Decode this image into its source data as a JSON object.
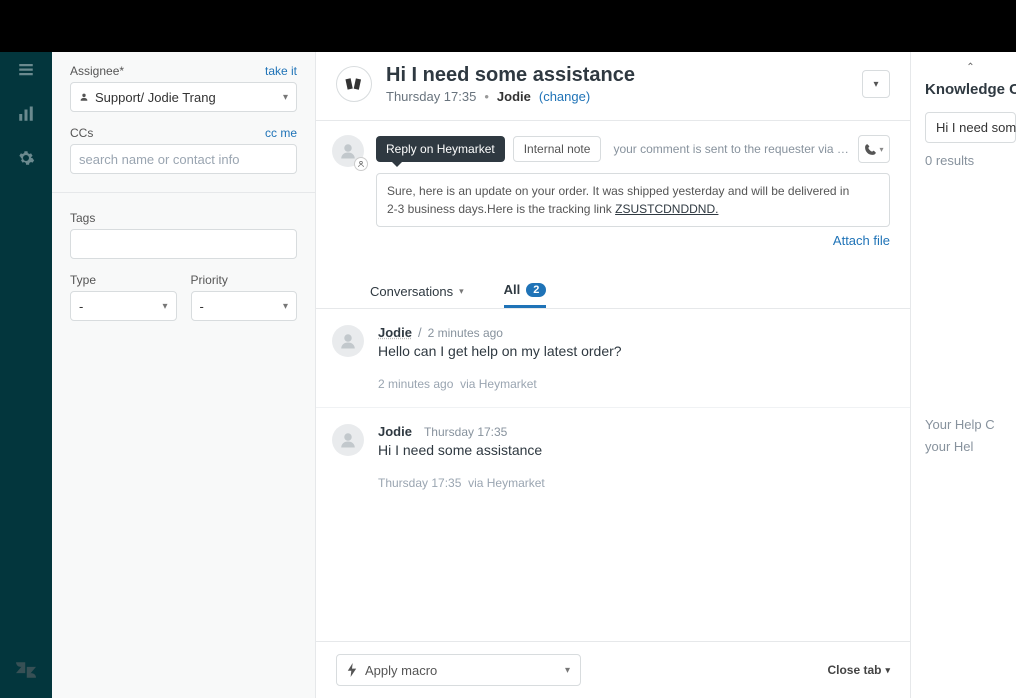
{
  "sidebar": {
    "assignee_label": "Assignee*",
    "take_it": "take it",
    "assignee_value": "Support/ Jodie Trang",
    "ccs_label": "CCs",
    "cc_me": "cc me",
    "ccs_placeholder": "search name or contact info",
    "tags_label": "Tags",
    "type_label": "Type",
    "type_value": "-",
    "priority_label": "Priority",
    "priority_value": "-"
  },
  "header": {
    "title": "Hi I need some assistance",
    "timestamp": "Thursday 17:35",
    "requester": "Jodie",
    "change": "(change)"
  },
  "reply": {
    "tab_primary": "Reply on Heymarket",
    "tab_internal": "Internal note",
    "hint": "your comment is sent to the requester via M...",
    "body_a": "Sure, here is an update on your order. It was shipped yesterday and will be delivered in",
    "body_b": "2-3 business days.Here is the tracking link ",
    "tracking": "ZSUSTCDNDDND.",
    "attach": "Attach file"
  },
  "conv_tabs": {
    "conversations": "Conversations",
    "all": "All",
    "count": "2"
  },
  "messages": [
    {
      "name": "Jodie",
      "sep": "/",
      "time": "2 minutes ago",
      "text": "Hello can I get help on my latest order?",
      "meta_time": "2 minutes ago",
      "meta_via": "via Heymarket"
    },
    {
      "name": "Jodie",
      "time": "Thursday 17:35",
      "text": "Hi I need some assistance",
      "meta_time": "Thursday 17:35",
      "meta_via": "via Heymarket"
    }
  ],
  "footer": {
    "macro": "Apply macro",
    "close": "Close tab"
  },
  "right": {
    "title": "Knowledge Cap",
    "search": "Hi I need some",
    "results": "0 results",
    "help1": "Your Help C",
    "help2": "your Hel"
  }
}
